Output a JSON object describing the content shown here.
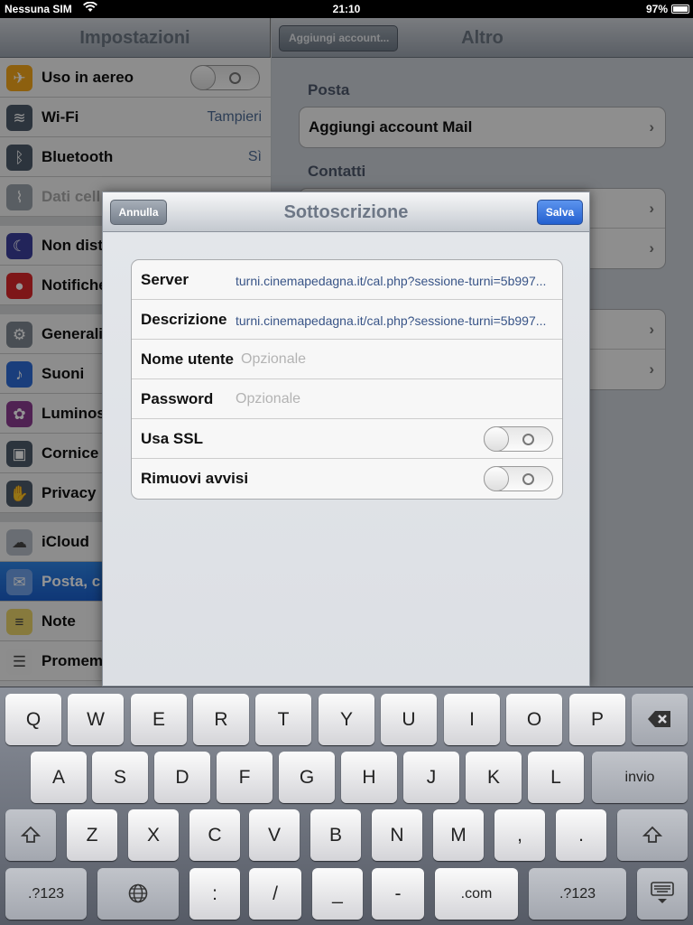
{
  "statusbar": {
    "carrier": "Nessuna SIM",
    "time": "21:10",
    "battery": "97%"
  },
  "master": {
    "title": "Impostazioni",
    "items": [
      {
        "label": "Uso in aereo",
        "value": "",
        "icon": "airplane-icon",
        "color": "#f3a51b"
      },
      {
        "label": "Wi-Fi",
        "value": "Tampieri",
        "icon": "wifi-icon",
        "color": "#4d5a69"
      },
      {
        "label": "Bluetooth",
        "value": "Sì",
        "icon": "bluetooth-icon",
        "color": "#4d5a69"
      },
      {
        "label": "Dati cell",
        "value": "",
        "icon": "cellular-icon",
        "color": "#9aa3ab"
      },
      {
        "label": "Non dist",
        "value": "",
        "icon": "moon-icon",
        "color": "#3b3f9c"
      },
      {
        "label": "Notifiche",
        "value": "",
        "icon": "notifications-icon",
        "color": "#d9262a"
      },
      {
        "label": "Generali",
        "value": "",
        "icon": "gear-icon",
        "color": "#7e8791"
      },
      {
        "label": "Suoni",
        "value": "",
        "icon": "speaker-icon",
        "color": "#2e6bd6"
      },
      {
        "label": "Luminos",
        "value": "",
        "icon": "brightness-icon",
        "color": "#8a3c8f"
      },
      {
        "label": "Cornice",
        "value": "",
        "icon": "frame-icon",
        "color": "#4d5a69"
      },
      {
        "label": "Privacy",
        "value": "",
        "icon": "hand-icon",
        "color": "#4d5a69"
      },
      {
        "label": "iCloud",
        "value": "",
        "icon": "cloud-icon",
        "color": "#b5bcc6"
      },
      {
        "label": "Posta, c",
        "value": "",
        "icon": "mail-icon",
        "color": "#6ea0e8"
      },
      {
        "label": "Note",
        "value": "",
        "icon": "notes-icon",
        "color": "#e8d36a"
      },
      {
        "label": "Promem",
        "value": "",
        "icon": "reminders-icon",
        "color": "#f2f2f2"
      }
    ]
  },
  "detail": {
    "back": "Aggiungi account...",
    "title": "Altro",
    "section_posta": "Posta",
    "add_mail": "Aggiungi account Mail",
    "section_contatti": "Contatti"
  },
  "modal": {
    "title": "Sottoscrizione",
    "cancel": "Annulla",
    "save": "Salva",
    "fields": {
      "server_label": "Server",
      "server_value": "turni.cinemapedagna.it/cal.php?sessione-turni=5b997...",
      "descr_label": "Descrizione",
      "descr_value": "turni.cinemapedagna.it/cal.php?sessione-turni=5b997...",
      "user_label": "Nome utente",
      "user_placeholder": "Opzionale",
      "pass_label": "Password",
      "pass_placeholder": "Opzionale",
      "ssl_label": "Usa SSL",
      "ssl_on": false,
      "alerts_label": "Rimuovi avvisi",
      "alerts_on": false
    }
  },
  "keyboard": {
    "row1": [
      "Q",
      "W",
      "E",
      "R",
      "T",
      "Y",
      "U",
      "I",
      "O",
      "P"
    ],
    "row2": [
      "A",
      "S",
      "D",
      "F",
      "G",
      "H",
      "J",
      "K",
      "L"
    ],
    "return": "invio",
    "row3": [
      "Z",
      "X",
      "C",
      "V",
      "B",
      "N",
      "M",
      ",",
      "."
    ],
    "num": ".?123",
    "row4": [
      ":",
      "/",
      "_",
      "-",
      ".com"
    ]
  }
}
